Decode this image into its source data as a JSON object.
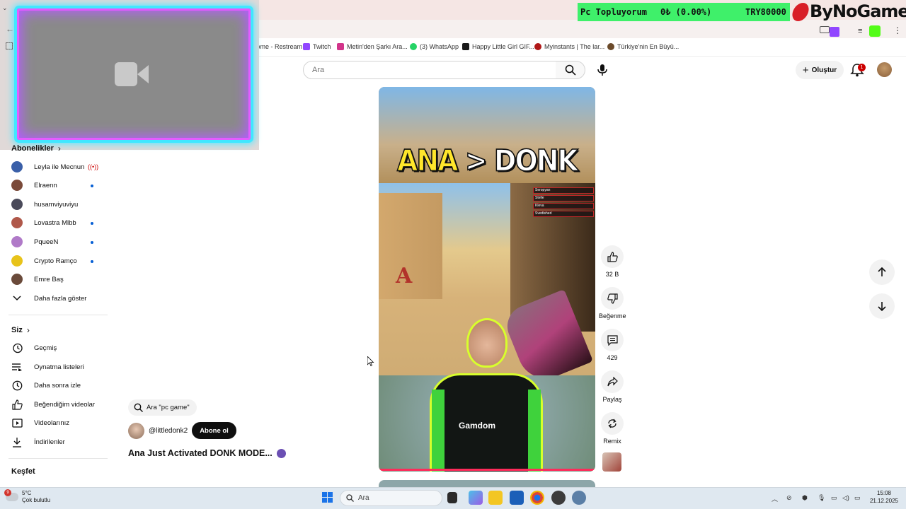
{
  "browser": {
    "bookmarks": [
      {
        "label": "Home - Restream",
        "color": "#ffffff"
      },
      {
        "label": "Twitch",
        "color": "#9146ff"
      },
      {
        "label": "Metin'den Şarkı Ara...",
        "color": "#d2348a"
      },
      {
        "label": "(3) WhatsApp",
        "color": "#25d366"
      },
      {
        "label": "Happy Little Girl GIF...",
        "color": "#1a1a1a"
      },
      {
        "label": "Myinstants | The lar...",
        "color": "#b01717"
      },
      {
        "label": "Türkiye'nin En Büyü...",
        "color": "#6b4a2a"
      }
    ]
  },
  "overlay": {
    "ticker_label": "Pc Topluyorum",
    "ticker_progress": "0₺ (0.00%)",
    "ticker_goal": "TRY80000",
    "brand": "ByNoGame",
    "progress_fraction": 0.0
  },
  "header": {
    "search_placeholder": "Ara",
    "create_label": "Oluştur",
    "notification_count": "1"
  },
  "sidebar": {
    "subscriptions_title": "Abonelikler",
    "subscriptions": [
      {
        "name": "Leyla ile Mecnun",
        "live": true,
        "color": "#3a5fa8"
      },
      {
        "name": "Elraenn",
        "new": true,
        "color": "#7a4a3a"
      },
      {
        "name": "husamviyuviyu",
        "new": false,
        "color": "#4a4a5a"
      },
      {
        "name": "Lovastra Mlbb",
        "new": true,
        "color": "#b0584a"
      },
      {
        "name": "PqueeN",
        "new": true,
        "color": "#b07ac8"
      },
      {
        "name": "Crypto Ramço",
        "new": true,
        "color": "#e8c31a"
      },
      {
        "name": "Emre Baş",
        "new": false,
        "color": "#6a4a3a"
      }
    ],
    "show_more": "Daha fazla göster",
    "you_title": "Siz",
    "you_items": [
      {
        "label": "Geçmiş",
        "icon": "history-icon"
      },
      {
        "label": "Oynatma listeleri",
        "icon": "playlists-icon"
      },
      {
        "label": "Daha sonra izle",
        "icon": "watch-later-icon"
      },
      {
        "label": "Beğendiğim videolar",
        "icon": "liked-icon"
      },
      {
        "label": "Videolarınız",
        "icon": "your-videos-icon"
      },
      {
        "label": "İndirilenler",
        "icon": "downloads-icon"
      }
    ],
    "explore_title": "Keşfet"
  },
  "short": {
    "search_chip": "Ara \"pc game\"",
    "channel": "@littledonk2",
    "subscribe_label": "Abone ol",
    "title": "Ana Just Activated DONK MODE...",
    "video_caption_a": "ANA",
    "video_caption_sep": ">",
    "video_caption_b": "DONK",
    "video_letter": "A",
    "jersey_brand": "Gamdom",
    "killfeed": [
      "Seropyan",
      "Stelle",
      "Kleva",
      "Svedished"
    ]
  },
  "actions": {
    "like_count": "32 B",
    "dislike_label": "Beğenme",
    "comment_count": "429",
    "share_label": "Paylaş",
    "remix_label": "Remix"
  },
  "taskbar": {
    "weather_temp": "5°C",
    "weather_desc": "Çok bulutlu",
    "search_label": "Ara",
    "time": "15:08",
    "date": "21.12.2025"
  }
}
